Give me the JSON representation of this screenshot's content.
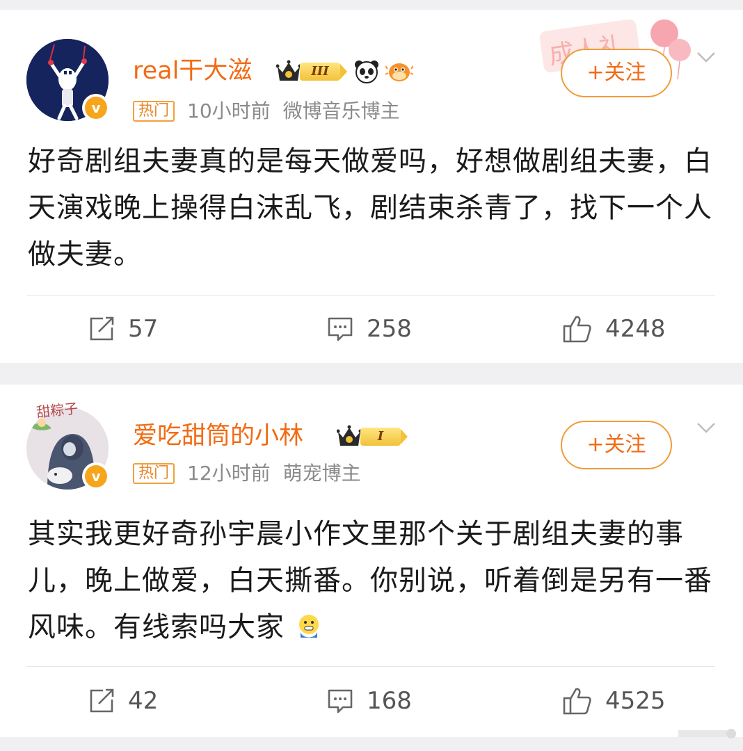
{
  "posts": [
    {
      "username": "real干大滋",
      "level_badge": "III",
      "tag": "热门",
      "time": "10小时前",
      "role": "微博音乐博主",
      "follow_label": "+关注",
      "decoration_text": "成人礼",
      "content": "好奇剧组夫妻真的是每天做爱吗，好想做剧组夫妻，白天演戏晚上操得白沫乱飞，剧结束杀青了，找下一个人做夫妻。",
      "reposts": "57",
      "comments": "258",
      "likes": "4248"
    },
    {
      "username": "爱吃甜筒的小林",
      "level_badge": "I",
      "tag": "热门",
      "time": "12小时前",
      "role": "萌宠博主",
      "follow_label": "+关注",
      "avatar_text": "甜粽子",
      "content": "其实我更好奇孙宇晨小作文里那个关于剧组夫妻的事儿，晚上做爱，白天撕番。你别说，听着倒是另有一番风味。有线索吗大家",
      "content_emoji": "shivering-face-emoji",
      "reposts": "42",
      "comments": "168",
      "likes": "4525"
    }
  ],
  "colors": {
    "username": "#f26b14",
    "follow_border": "#f29b3a",
    "hot_tag": "#e7892a",
    "verified_badge": "#f7a51c",
    "meta_text": "#8a8a8a",
    "background": "#f0f0f2"
  },
  "icons": {
    "repost": "repost-icon",
    "comment": "comment-icon",
    "like": "thumbs-up-icon",
    "more": "chevron-down-icon",
    "verified": "verified-v-icon",
    "crown": "crown-icon",
    "panda": "panda-icon",
    "fish": "pufferfish-icon"
  }
}
